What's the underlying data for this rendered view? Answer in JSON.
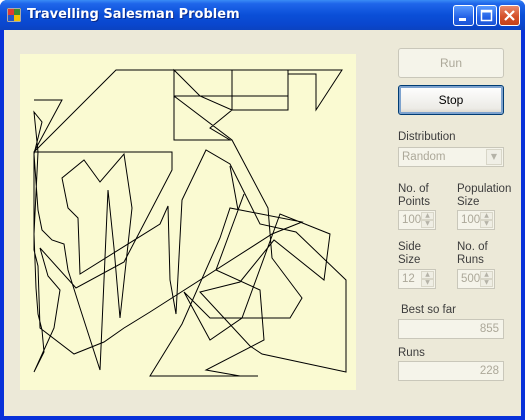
{
  "window": {
    "title": "Travelling Salesman Problem"
  },
  "buttons": {
    "run_label": "Run",
    "stop_label": "Stop"
  },
  "distribution": {
    "label": "Distribution",
    "selected": "Random"
  },
  "params": {
    "points_label_1": "No. of",
    "points_label_2": "Points",
    "points_value": "100",
    "population_label_1": "Population",
    "population_label_2": "Size",
    "population_value": "100",
    "side_label_1": "Side",
    "side_label_2": "Size",
    "side_value": "12",
    "runs_label_1": "No. of",
    "runs_label_2": "Runs",
    "runs_value": "500"
  },
  "results": {
    "best_label": "Best so far",
    "best_value": "855",
    "runs_label": "Runs",
    "runs_value": "228"
  },
  "colors": {
    "title_bar": "#0a4fd8",
    "canvas_background": "#fafad2",
    "window_background": "#ece9d8"
  },
  "icons": [
    "app-icon",
    "minimize-icon",
    "maximize-icon",
    "close-icon"
  ]
}
